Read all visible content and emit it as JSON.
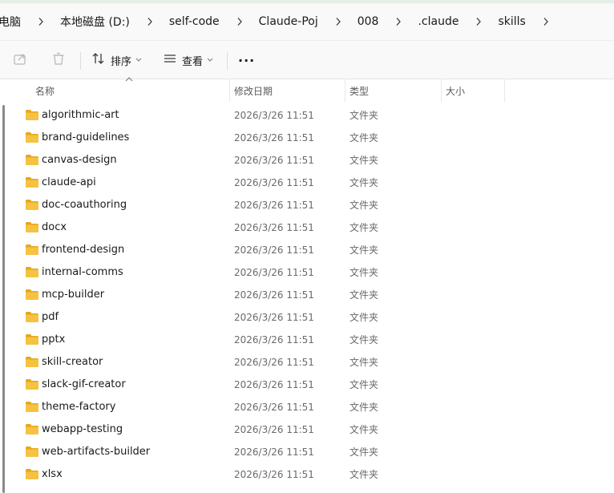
{
  "breadcrumb": [
    "电脑",
    "本地磁盘 (D:)",
    "self-code",
    "Claude-Poj",
    "008",
    ".claude",
    "skills"
  ],
  "toolbar": {
    "sort_label": "排序",
    "view_label": "查看",
    "more_label": "···"
  },
  "columns": {
    "name": "名称",
    "modified": "修改日期",
    "type": "类型",
    "size": "大小"
  },
  "colors": {
    "folder_body": "#f5c242",
    "folder_tab": "#e6a817",
    "accent": "#0067c0"
  },
  "files": [
    {
      "name": "algorithmic-art",
      "modified": "2026/3/26 11:51",
      "type": "文件夹"
    },
    {
      "name": "brand-guidelines",
      "modified": "2026/3/26 11:51",
      "type": "文件夹"
    },
    {
      "name": "canvas-design",
      "modified": "2026/3/26 11:51",
      "type": "文件夹"
    },
    {
      "name": "claude-api",
      "modified": "2026/3/26 11:51",
      "type": "文件夹"
    },
    {
      "name": "doc-coauthoring",
      "modified": "2026/3/26 11:51",
      "type": "文件夹"
    },
    {
      "name": "docx",
      "modified": "2026/3/26 11:51",
      "type": "文件夹"
    },
    {
      "name": "frontend-design",
      "modified": "2026/3/26 11:51",
      "type": "文件夹"
    },
    {
      "name": "internal-comms",
      "modified": "2026/3/26 11:51",
      "type": "文件夹"
    },
    {
      "name": "mcp-builder",
      "modified": "2026/3/26 11:51",
      "type": "文件夹"
    },
    {
      "name": "pdf",
      "modified": "2026/3/26 11:51",
      "type": "文件夹"
    },
    {
      "name": "pptx",
      "modified": "2026/3/26 11:51",
      "type": "文件夹"
    },
    {
      "name": "skill-creator",
      "modified": "2026/3/26 11:51",
      "type": "文件夹"
    },
    {
      "name": "slack-gif-creator",
      "modified": "2026/3/26 11:51",
      "type": "文件夹"
    },
    {
      "name": "theme-factory",
      "modified": "2026/3/26 11:51",
      "type": "文件夹"
    },
    {
      "name": "webapp-testing",
      "modified": "2026/3/26 11:51",
      "type": "文件夹"
    },
    {
      "name": "web-artifacts-builder",
      "modified": "2026/3/26 11:51",
      "type": "文件夹"
    },
    {
      "name": "xlsx",
      "modified": "2026/3/26 11:51",
      "type": "文件夹"
    }
  ]
}
